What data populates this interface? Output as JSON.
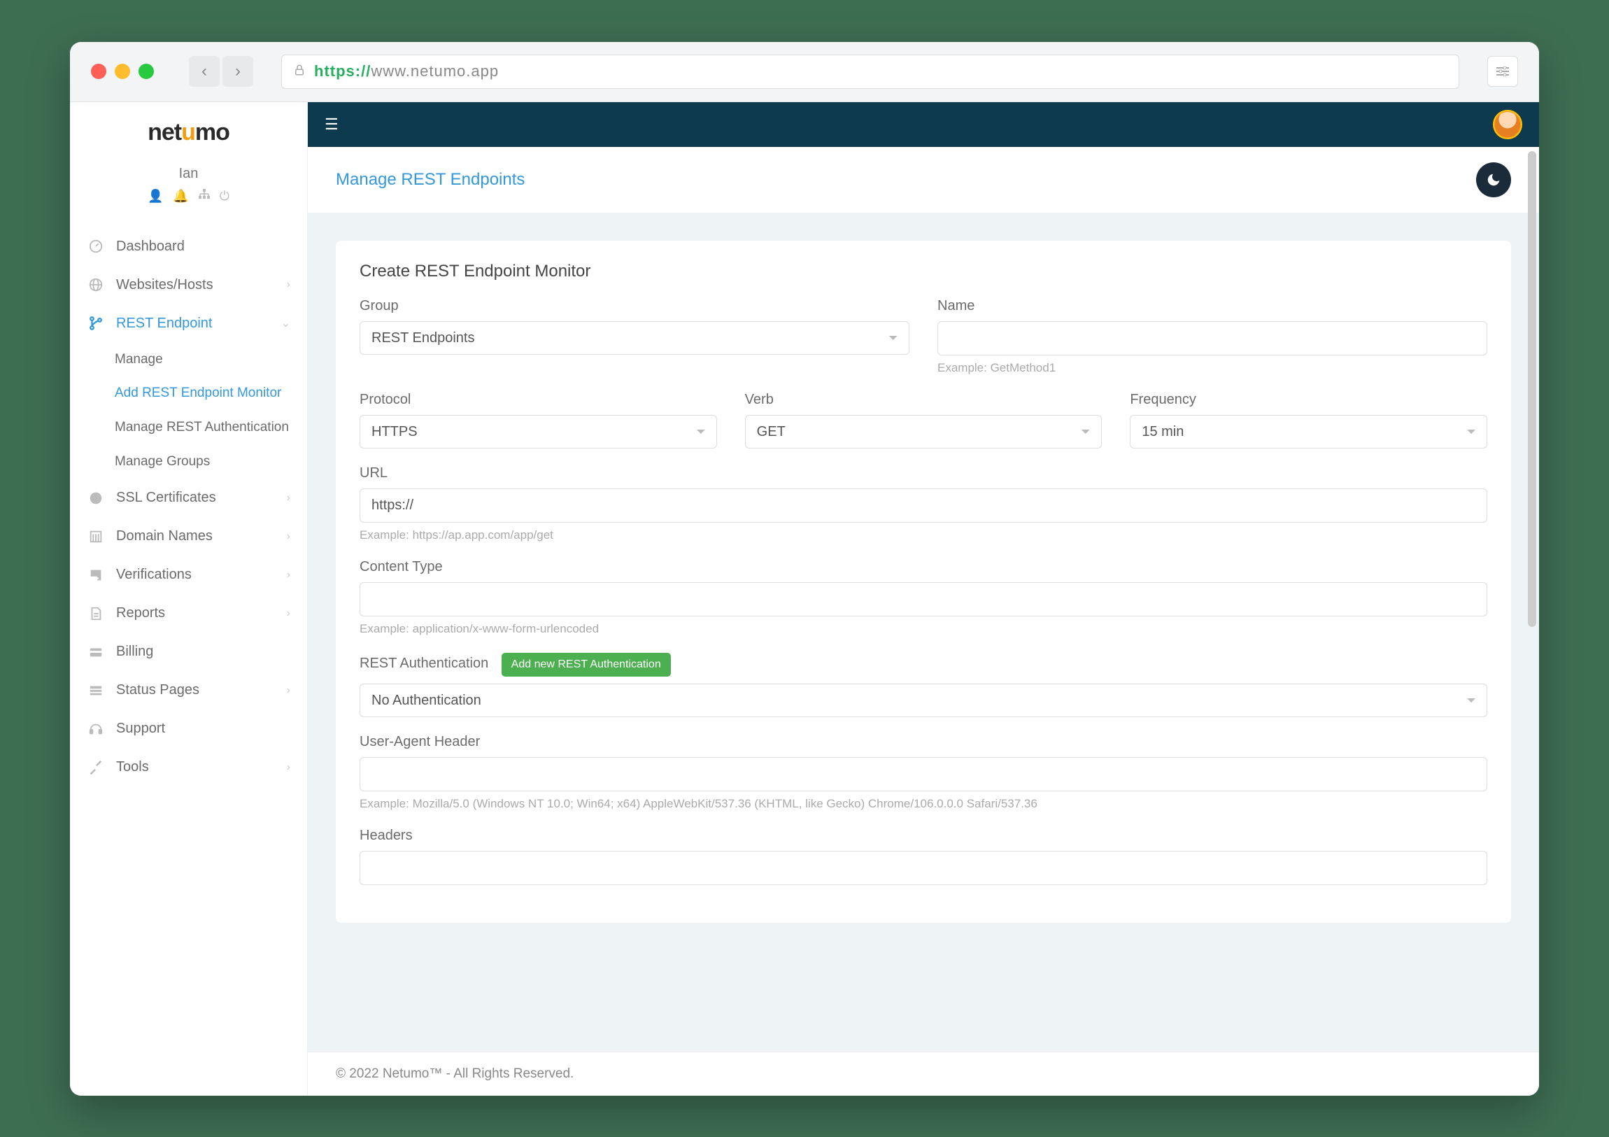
{
  "browser": {
    "url_scheme": "https://",
    "url_host": "www.netumo.app"
  },
  "app": {
    "logo_pre": "net",
    "logo_accent": "u",
    "logo_post": "mo",
    "user_name": "Ian"
  },
  "sidebar": {
    "items": [
      {
        "label": "Dashboard",
        "expandable": false
      },
      {
        "label": "Websites/Hosts",
        "expandable": true
      },
      {
        "label": "REST Endpoint",
        "expandable": true,
        "active": true
      },
      {
        "label": "SSL Certificates",
        "expandable": true
      },
      {
        "label": "Domain Names",
        "expandable": true
      },
      {
        "label": "Verifications",
        "expandable": true
      },
      {
        "label": "Reports",
        "expandable": true
      },
      {
        "label": "Billing",
        "expandable": false
      },
      {
        "label": "Status Pages",
        "expandable": true
      },
      {
        "label": "Support",
        "expandable": false
      },
      {
        "label": "Tools",
        "expandable": true
      }
    ],
    "rest_sub": [
      {
        "label": "Manage"
      },
      {
        "label": "Add REST Endpoint Monitor",
        "active": true
      },
      {
        "label": "Manage REST Authentication"
      },
      {
        "label": "Manage Groups"
      }
    ]
  },
  "page": {
    "header_title": "Manage REST Endpoints",
    "card_title": "Create REST Endpoint Monitor"
  },
  "form": {
    "group_label": "Group",
    "group_value": "REST Endpoints",
    "name_label": "Name",
    "name_hint": "Example: GetMethod1",
    "protocol_label": "Protocol",
    "protocol_value": "HTTPS",
    "verb_label": "Verb",
    "verb_value": "GET",
    "frequency_label": "Frequency",
    "frequency_value": "15 min",
    "url_label": "URL",
    "url_value": "https://",
    "url_hint": "Example: https://ap.app.com/app/get",
    "content_type_label": "Content Type",
    "content_type_hint": "Example: application/x-www-form-urlencoded",
    "auth_label": "REST Authentication",
    "auth_button": "Add new REST Authentication",
    "auth_value": "No Authentication",
    "ua_label": "User-Agent Header",
    "ua_hint": "Example: Mozilla/5.0 (Windows NT 10.0; Win64; x64) AppleWebKit/537.36 (KHTML, like Gecko) Chrome/106.0.0.0 Safari/537.36",
    "headers_label": "Headers"
  },
  "footer": {
    "text": "© 2022 Netumo™ - All Rights Reserved."
  }
}
